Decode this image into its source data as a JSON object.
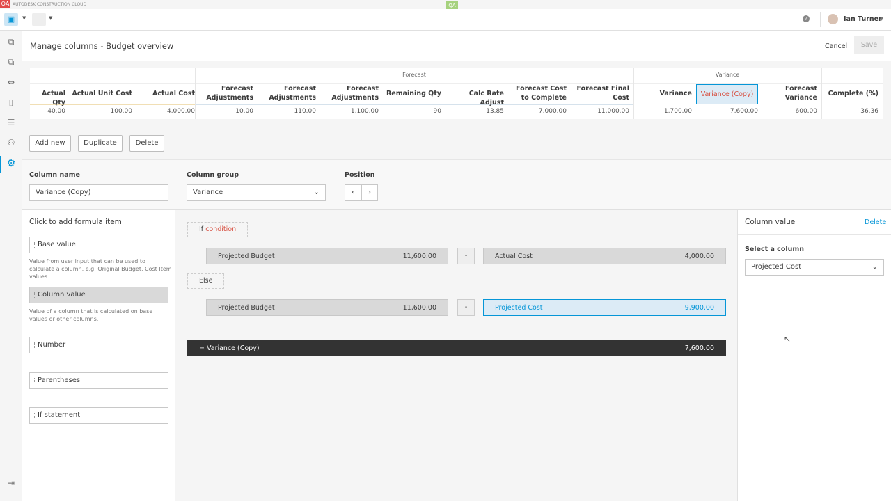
{
  "app": {
    "qa_badge": "QA",
    "brand": "AUTODESK CONSTRUCTION CLOUD",
    "env_badge": "QA",
    "user_name": "Ian Turner"
  },
  "page": {
    "title": "Manage columns - Budget overview",
    "cancel": "Cancel",
    "save": "Save"
  },
  "table": {
    "groups": {
      "forecast": "Forecast",
      "variance": "Variance"
    },
    "columns": [
      {
        "header": "Actual Qty",
        "value": "40.00"
      },
      {
        "header": "Actual Unit Cost",
        "value": "100.00"
      },
      {
        "header": "Actual Cost",
        "value": "4,000.00"
      },
      {
        "header": "Forecast Adjustments",
        "value": "10.00"
      },
      {
        "header": "Forecast Adjustments",
        "value": "110.00"
      },
      {
        "header": "Forecast Adjustments",
        "value": "1,100.00"
      },
      {
        "header": "Remaining Qty",
        "value": "90"
      },
      {
        "header": "Calc Rate Adjust",
        "value": "13.85"
      },
      {
        "header": "Forecast Cost to Complete",
        "value": "7,000.00"
      },
      {
        "header": "Forecast Final Cost",
        "value": "11,000.00"
      },
      {
        "header": "Variance",
        "value": "1,700.00"
      },
      {
        "header": "Variance (Copy)",
        "value": "7,600.00"
      },
      {
        "header": "Forecast Variance",
        "value": "600.00"
      },
      {
        "header": "Complete (%)",
        "value": "36.36"
      }
    ]
  },
  "actions": {
    "add_new": "Add new",
    "duplicate": "Duplicate",
    "delete": "Delete"
  },
  "form": {
    "column_name_label": "Column name",
    "column_name": "Variance (Copy)",
    "column_group_label": "Column group",
    "column_group": "Variance",
    "position_label": "Position"
  },
  "palette": {
    "title": "Click to add formula item",
    "items": [
      {
        "label": "Base value",
        "desc": "Value from user input that can be used to calculate a column, e.g. Original Budget, Cost Item values."
      },
      {
        "label": "Column value",
        "desc": "Value of a column that is calculated on base values or other columns."
      },
      {
        "label": "Number"
      },
      {
        "label": "Parentheses"
      },
      {
        "label": "If statement"
      }
    ]
  },
  "formula": {
    "if": "If",
    "condition": "condition",
    "else": "Else",
    "row1": {
      "left": "Projected Budget",
      "left_value": "11,600.00",
      "op": "-",
      "right": "Actual Cost",
      "right_value": "4,000.00"
    },
    "row2": {
      "left": "Projected Budget",
      "left_value": "11,600.00",
      "op": "-",
      "right": "Projected Cost",
      "right_value": "9,900.00"
    },
    "result_label": "= Variance (Copy)",
    "result_value": "7,600.00"
  },
  "side": {
    "title": "Column value",
    "delete": "Delete",
    "select_label": "Select a column",
    "selected": "Projected Cost"
  },
  "colors": {
    "accent": "#0696d7",
    "red": "#d74e3f",
    "dark": "#333333"
  }
}
